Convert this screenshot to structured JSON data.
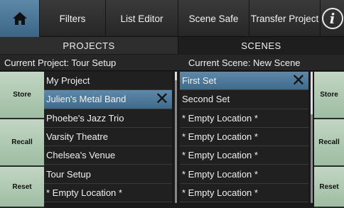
{
  "topbar": {
    "home_icon": "home-icon",
    "buttons": [
      "Filters",
      "List Editor",
      "Scene Safe",
      "Transfer Project"
    ],
    "info_label": "i"
  },
  "sections": {
    "projects": "PROJECTS",
    "scenes": "SCENES"
  },
  "current": {
    "project": "Current Project:  Tour Setup",
    "scene": "Current Scene:  New Scene"
  },
  "side_buttons": {
    "store": "Store",
    "recall": "Recall",
    "reset": "Reset"
  },
  "projects": [
    {
      "label": "My Project"
    },
    {
      "label": "Julien's Metal Band",
      "selected": true
    },
    {
      "label": "Phoebe's Jazz Trio"
    },
    {
      "label": "Varsity Theatre"
    },
    {
      "label": "Chelsea's Venue"
    },
    {
      "label": "Tour Setup"
    },
    {
      "label": "* Empty Location *"
    }
  ],
  "scenes": [
    {
      "label": "First Set",
      "selected": true
    },
    {
      "label": "Second Set"
    },
    {
      "label": "* Empty Location *"
    },
    {
      "label": "* Empty Location *"
    },
    {
      "label": "* Empty Location *"
    },
    {
      "label": "* Empty Location *"
    },
    {
      "label": "* Empty Location *"
    }
  ],
  "delete_glyph": "✕",
  "colors": {
    "selected": "#4f7a9b",
    "side_button": "#b2cbb5",
    "home": "#4d7797"
  }
}
